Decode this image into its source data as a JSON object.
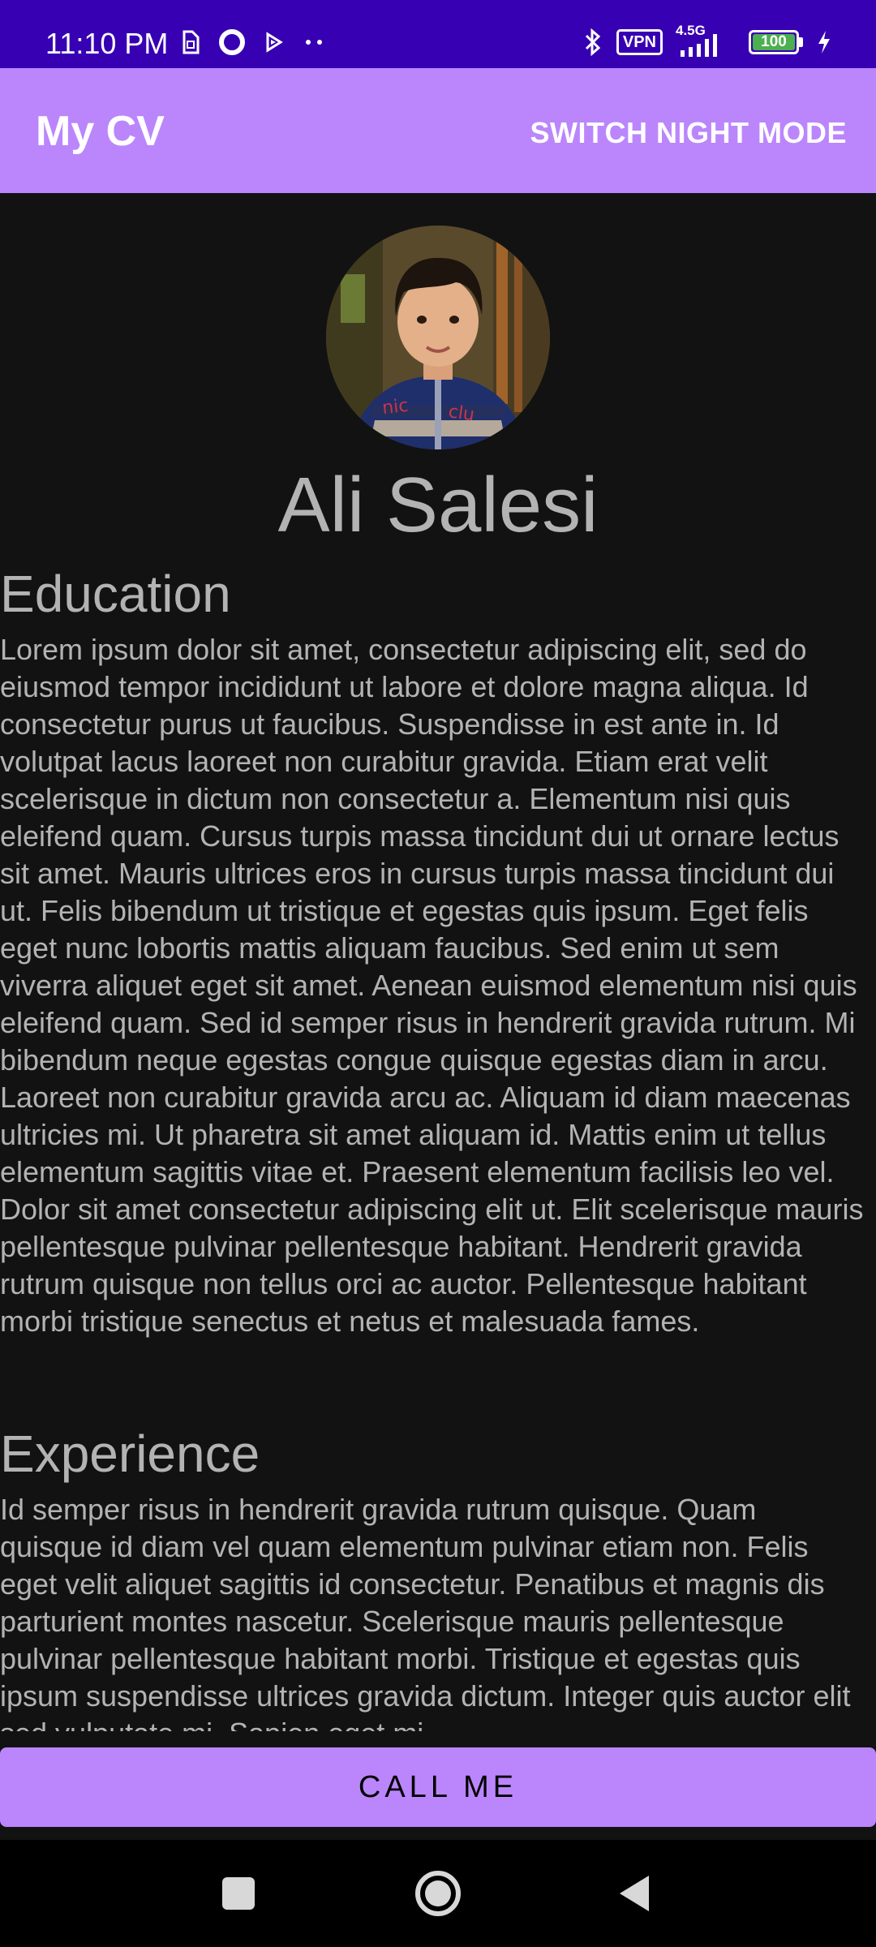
{
  "status_bar": {
    "time": "11:10 PM",
    "vpn_label": "VPN",
    "network_label": "4.5G",
    "battery_level": "100",
    "left_icons": [
      "sim-icon",
      "circle-icon",
      "play-icon",
      "more-dots-icon"
    ],
    "right_icons": [
      "bluetooth-icon",
      "vpn-badge",
      "signal-icon",
      "battery-icon",
      "charging-icon"
    ],
    "battery_color": "#4caf50"
  },
  "app_bar": {
    "title": "My CV",
    "action_label": "SWITCH NIGHT MODE",
    "background": "#bb86fc"
  },
  "profile": {
    "name": "Ali Salesi"
  },
  "sections": [
    {
      "title": "Education",
      "body": "Lorem ipsum dolor sit amet, consectetur adipiscing elit, sed do eiusmod tempor incididunt ut labore et dolore magna aliqua. Id consectetur purus ut faucibus. Suspendisse in est ante in. Id volutpat lacus laoreet non curabitur gravida. Etiam erat velit scelerisque in dictum non consectetur a. Elementum nisi quis eleifend quam. Cursus turpis massa tincidunt dui ut ornare lectus sit amet. Mauris ultrices eros in cursus turpis massa tincidunt dui ut. Felis bibendum ut tristique et egestas quis ipsum. Eget felis eget nunc lobortis mattis aliquam faucibus. Sed enim ut sem viverra aliquet eget sit amet. Aenean euismod elementum nisi quis eleifend quam. Sed id semper risus in hendrerit gravida rutrum. Mi bibendum neque egestas congue quisque egestas diam in arcu. Laoreet non curabitur gravida arcu ac. Aliquam id diam maecenas ultricies mi. Ut pharetra sit amet aliquam id. Mattis enim ut tellus elementum sagittis vitae et. Praesent elementum facilisis leo vel. Dolor sit amet consectetur adipiscing elit ut. Elit scelerisque mauris pellentesque pulvinar pellentesque habitant. Hendrerit gravida rutrum quisque non tellus orci ac auctor. Pellentesque habitant morbi tristique senectus et netus et malesuada fames."
    },
    {
      "title": "Experience",
      "body": "Id semper risus in hendrerit gravida rutrum quisque. Quam quisque id diam vel quam elementum pulvinar etiam non. Felis eget velit aliquet sagittis id consectetur. Penatibus et magnis dis parturient montes nascetur. Scelerisque mauris pellentesque pulvinar pellentesque habitant morbi. Tristique et egestas quis ipsum suspendisse ultrices gravida dictum. Integer quis auctor elit sed vulputate mi. Sapien eget mi"
    }
  ],
  "call_button": {
    "label": "CALL ME"
  },
  "nav_bar": {
    "buttons": [
      "recents-icon",
      "home-icon",
      "back-icon"
    ]
  }
}
